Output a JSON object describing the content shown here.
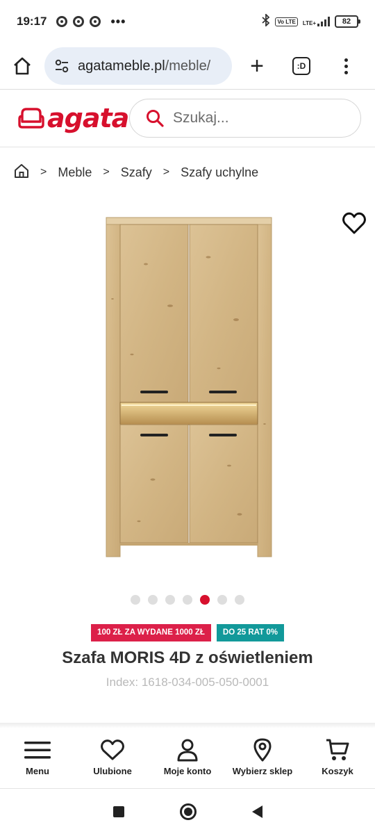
{
  "status_bar": {
    "time": "19:17",
    "battery": "82",
    "more": "•••",
    "network": "LTE+",
    "volte": "Vo LTE"
  },
  "browser": {
    "url_host": "agatameble.pl",
    "url_path": "/meble/",
    "tab_count_label": ":D",
    "new_tab_label": "+"
  },
  "header": {
    "logo_text": "agata",
    "search_placeholder": "Szukaj..."
  },
  "breadcrumb": {
    "items": [
      "Meble",
      "Szafy",
      "Szafy uchylne"
    ],
    "separator": ">"
  },
  "carousel": {
    "count": 7,
    "active_index": 4
  },
  "product": {
    "badge_promo": "100 ZŁ ZA WYDANE 1000 ZŁ",
    "badge_installments": "DO 25 RAT 0%",
    "title": "Szafa MORIS 4D z oświetleniem",
    "index": "Index: 1618-034-005-050-0001"
  },
  "bottom_nav": {
    "menu": "Menu",
    "favorites": "Ulubione",
    "account": "Moje konto",
    "store": "Wybierz sklep",
    "cart": "Koszyk"
  },
  "colors": {
    "brand": "#d7102d",
    "badge_red": "#dc2049",
    "badge_teal": "#12999a",
    "url_bg": "#e8eef7"
  }
}
